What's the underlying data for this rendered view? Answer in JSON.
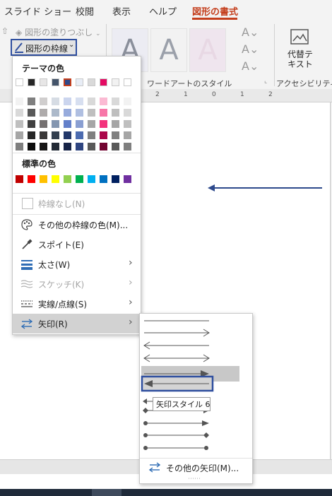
{
  "tabs": {
    "slideshow": "スライド ショー",
    "review": "校閲",
    "view": "表示",
    "help": "ヘルプ",
    "shape_format": "図形の書式"
  },
  "ribbon": {
    "shape_fill": "図形の塗りつぶし",
    "shape_outline": "図形の枠線",
    "wordart_styles": "ワードアートのスタイル",
    "accessibility": "アクセシビリティ",
    "alt_text_line1": "代替テ",
    "alt_text_line2": "キスト",
    "wordart_letter": "A"
  },
  "ruler": {
    "marks": [
      "2",
      "1",
      "0",
      "1",
      "2"
    ]
  },
  "menu": {
    "theme_colors_heading": "テーマの色",
    "standard_colors_heading": "標準の色",
    "theme_colors": [
      "#ffffff",
      "#262626",
      "#e7e6e6",
      "#44546a",
      "#2e4a8c",
      "#e8edf6",
      "#d9d9d9",
      "#e40a63",
      "#f2f2f2",
      "#ffffff",
      "#ffffff"
    ],
    "standard_colors": [
      "#c00000",
      "#ff0000",
      "#ffc000",
      "#ffff00",
      "#92d050",
      "#00b050",
      "#00b0f0",
      "#0070c0",
      "#002060",
      "#7030a0"
    ],
    "items": {
      "no_outline": "枠線なし(N)",
      "more_colors": "その他の枠線の色(M)...",
      "eyedropper": "スポイト(E)",
      "weight": "太さ(W)",
      "sketched": "スケッチ(K)",
      "dashes": "実線/点線(S)",
      "arrows": "矢印(R)"
    }
  },
  "submenu": {
    "more_arrows": "その他の矢印(M)...",
    "tooltip": "矢印スタイル 6"
  },
  "colors": {
    "accent_red": "#c43e1c",
    "highlight_blue": "#2f4f9f",
    "slide_arrow": "#2e4a8c"
  }
}
